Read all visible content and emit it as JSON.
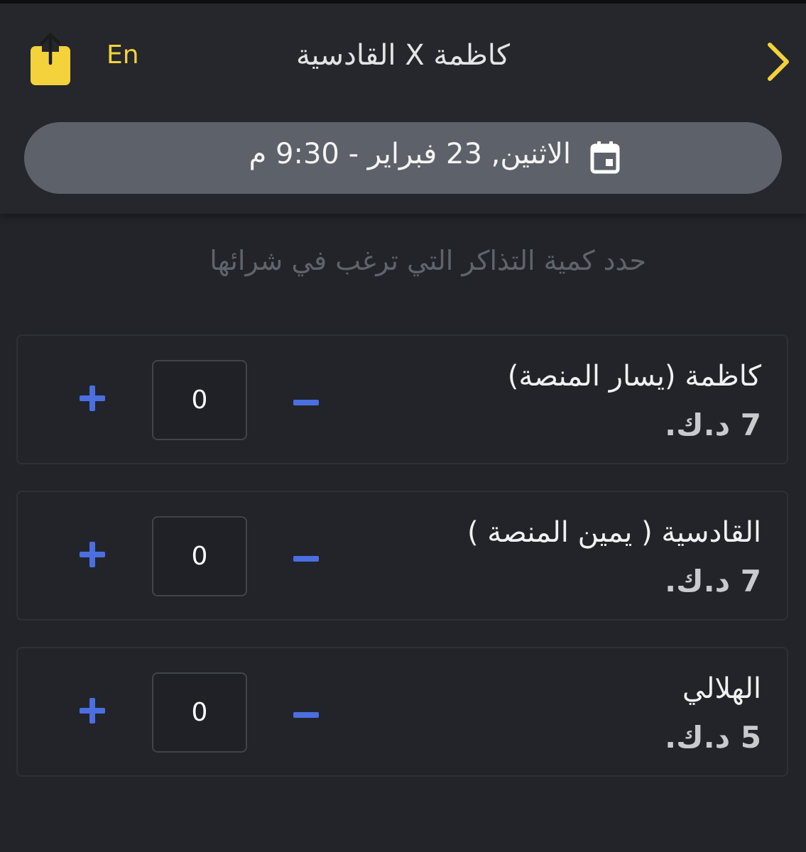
{
  "header": {
    "title": "كاظمة X القادسية",
    "lang_label": "En",
    "share_icon": "share-icon",
    "back_icon": "chevron-right-icon"
  },
  "date_selector": {
    "text": "الاثنين, 23 فبراير - 9:30 م",
    "icon": "calendar-icon"
  },
  "instruction": "حدد كمية التذاكر التي ترغب في شرائها",
  "tickets": [
    {
      "name": "كاظمة (يسار المنصة)",
      "price": "7 د.ك.",
      "quantity": "0"
    },
    {
      "name": "القادسية ( يمين المنصة )",
      "price": "7 د.ك.",
      "quantity": "0"
    },
    {
      "name": "الهلالي",
      "price": "5 د.ك.",
      "quantity": "0"
    }
  ],
  "colors": {
    "accent_yellow": "#f3d23b",
    "accent_blue": "#4a6fe0",
    "background": "#22242a",
    "pill": "#5d6169"
  }
}
